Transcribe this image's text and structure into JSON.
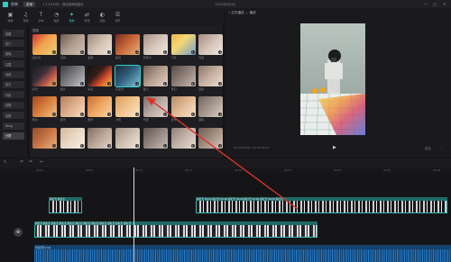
{
  "titlebar": {
    "app_name": "剪映",
    "menu_label": "菜单",
    "project_hint": "• 1 153 KB · 请连接网络重试",
    "center_title": "2023年8月4日",
    "win_controls": [
      "—",
      "□",
      "✕"
    ]
  },
  "toolbar": {
    "items": [
      {
        "label": "媒体",
        "icon": "▣"
      },
      {
        "label": "音频",
        "icon": "♫"
      },
      {
        "label": "文本",
        "icon": "T"
      },
      {
        "label": "贴纸",
        "icon": "◔"
      },
      {
        "label": "特效",
        "icon": "✦"
      },
      {
        "label": "转场",
        "icon": "⇄"
      },
      {
        "label": "滤镜",
        "icon": "◐"
      },
      {
        "label": "调节",
        "icon": "☰"
      }
    ],
    "active_index": 4
  },
  "sidebar": {
    "items": [
      "收藏",
      "热门",
      "基础",
      "氛围",
      "动感",
      "复古",
      "光影",
      "纹理",
      "边框",
      "Bling",
      "分屏"
    ],
    "active_index": 10
  },
  "grid": {
    "header": "氛围",
    "tiles": [
      {
        "label": "彩虹光",
        "bg": "linear-gradient(135deg,#c33,#f3a24d 45%,#e7d27a)"
      },
      {
        "label": "光斑",
        "bg": "linear-gradient(135deg,#6a5a50,#b29e90 50%,#cfc2b6)"
      },
      {
        "label": "烟雾",
        "bg": "linear-gradient(135deg,#9b8778,#d7c7b7 55%,#efe3d6)"
      },
      {
        "label": "星光",
        "bg": "linear-gradient(135deg,#7a2a22,#c96a3b 50%,#e8b07a)"
      },
      {
        "label": "粉色光",
        "bg": "linear-gradient(135deg,#a78d83,#d6c5bb 50%,#f3e8e0)"
      },
      {
        "label": "闪光",
        "bg": "linear-gradient(135deg,#e9b647,#f5d774 40%,#6f9fd0)"
      },
      {
        "label": "光晕",
        "bg": "linear-gradient(135deg,#a58b7f,#d8c8bd 55%,#f1e9e3)"
      },
      {
        "label": "彩光",
        "bg": "linear-gradient(135deg,#1a1a1c,#3a2f3a 40%,#c25b4a 70%,#e9c26b)"
      },
      {
        "label": "胶片",
        "bg": "linear-gradient(135deg,#3b3b3e,#7f7f83 50%,#c7c7cb)"
      },
      {
        "label": "彩虹",
        "bg": "linear-gradient(135deg,#111,#3a1f18 40%,#d24b2a 65%,#f1c64f)"
      },
      {
        "label": "幻彩光",
        "bg": "linear-gradient(135deg,#1d2a3a,#2e5d7b 45%,#7fc1d8)"
      },
      {
        "label": "星火",
        "bg": "linear-gradient(135deg,#6f5b52,#b79f90 50%,#e5d6c8)"
      },
      {
        "label": "梦幻",
        "bg": "linear-gradient(135deg,#554a46,#8f8078 50%,#c8bbb3)"
      },
      {
        "label": "变彩",
        "bg": "linear-gradient(135deg,#8b7367,#c8b1a2 50%,#eee0d5)"
      },
      {
        "label": "暖光",
        "bg": "linear-gradient(135deg,#a2451f,#d9803f 50%,#f0c28a)"
      },
      {
        "label": "柔光",
        "bg": "linear-gradient(135deg,#b37b5b,#e0b08c 50%,#f6dcc2)"
      },
      {
        "label": "橙光",
        "bg": "linear-gradient(135deg,#c96b2c,#eea864 50%,#f8d7a7)"
      },
      {
        "label": "夕阳",
        "bg": "linear-gradient(135deg,#d99a5a,#f1c58d 50%,#fbe6cb)"
      },
      {
        "label": "光束",
        "bg": "linear-gradient(135deg,#7a6b66,#b9aaa3 50%,#e2d7d1)"
      },
      {
        "label": "晨光",
        "bg": "linear-gradient(135deg,#b88a66,#e1bc97 50%,#f6e2cd)"
      },
      {
        "label": "暮色",
        "bg": "linear-gradient(135deg,#6e625f,#a8998f 50%,#dcd0c6)"
      },
      {
        "label": "",
        "bg": "linear-gradient(135deg,#8f4a2b,#c97646 50%,#eab383)"
      },
      {
        "label": "",
        "bg": "linear-gradient(135deg,#d2b79a,#ead9c5 50%,#f7eee3)"
      },
      {
        "label": "",
        "bg": "linear-gradient(135deg,#7f6d62,#b9a697 50%,#e3d6cb)"
      },
      {
        "label": "",
        "bg": "linear-gradient(135deg,#a0907f,#cfc1b2 50%,#efe6dc)"
      },
      {
        "label": "",
        "bg": "linear-gradient(135deg,#5e5450,#958781 50%,#c8bdb7)"
      },
      {
        "label": "",
        "bg": "linear-gradient(135deg,#8d7d73,#c3b3a8 50%,#e8ddd5)"
      },
      {
        "label": "",
        "bg": "linear-gradient(135deg,#6d5d52,#a38f80 50%,#d8c8ba)"
      }
    ],
    "selected_index": 10
  },
  "player": {
    "title": "• 正在播放 — 播放",
    "time": "00:00:00:00 / 00:00:56:23",
    "play_icon": "▶",
    "ctl_right": [
      "原始",
      "⛶"
    ]
  },
  "timeline_tools": [
    "↖",
    "↶",
    "↷",
    "✂"
  ],
  "ruler_ticks": [
    "00:00",
    "00:07",
    "00:14",
    "00:21",
    "00:28",
    "00:35",
    "00:42",
    "00:49",
    "00:56"
  ],
  "tracks": {
    "fx_short": "彩虹光 彩虹光",
    "fx_long": "彩虹光 00:00 彩虹光 00:00 彩虹光 00:00 彩虹光 00:00 彩虹光 00:00 彩虹光",
    "main": "彩虹光 彩虹光 彩虹光 彩虹光 彩虹光 彩虹光 彩虹光 彩虹光 彩虹光 彩虹光 彩虹光 彩虹光",
    "cover_icon": "⊕",
    "audio": "抖音原声mp4"
  },
  "colors": {
    "accent": "#2bd1c8",
    "arrow": "#d9322a"
  }
}
